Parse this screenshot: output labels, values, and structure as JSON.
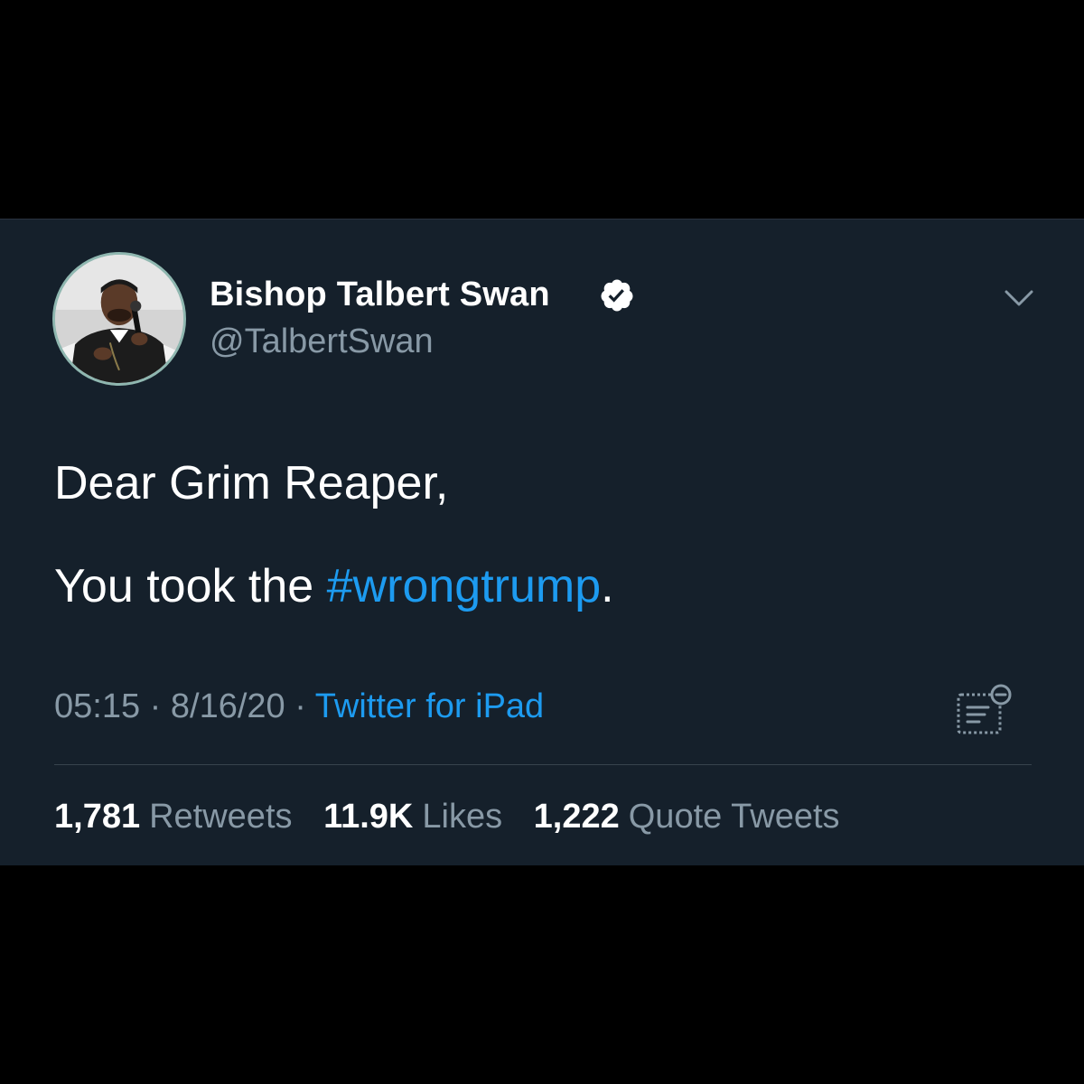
{
  "colors": {
    "background_outer": "#000000",
    "card_background": "#15202b",
    "text_primary": "#ffffff",
    "text_secondary": "#8899a6",
    "link": "#1d9bf0",
    "divider": "#38444d"
  },
  "tweet": {
    "author": {
      "display_name": "Bishop Talbert Swan",
      "handle": "@TalbertSwan",
      "verified": true,
      "avatar_icon": "profile-photo"
    },
    "text": {
      "line1": "Dear Grim Reaper,",
      "line2_prefix": "You took the ",
      "hashtag": "#wrongtrump",
      "line2_suffix": "."
    },
    "time": "05:15",
    "separator": "·",
    "date": "8/16/20",
    "source": "Twitter for iPad",
    "stats": {
      "retweets": {
        "count": "1,781",
        "label": "Retweets"
      },
      "likes": {
        "count": "11.9K",
        "label": "Likes"
      },
      "quotes": {
        "count": "1,222",
        "label": "Quote Tweets"
      }
    },
    "icons": {
      "verified": "verified-badge-icon",
      "menu": "chevron-down-icon",
      "analytics": "analytics-icon"
    }
  }
}
